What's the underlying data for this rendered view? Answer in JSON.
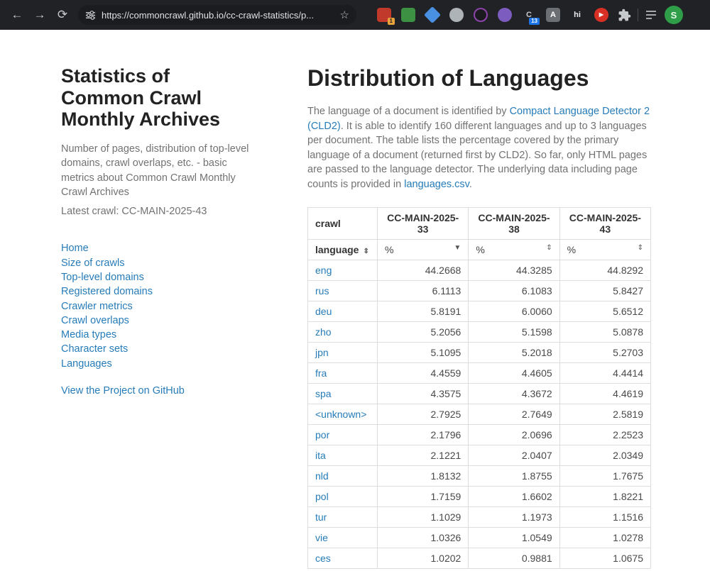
{
  "browser": {
    "url": "https://commoncrawl.github.io/cc-crawl-statistics/p...",
    "icons": {
      "back": "←",
      "forward": "→",
      "reload": "⟳",
      "star": "☆"
    },
    "avatar_letter": "S",
    "extensions": [
      {
        "name": "extension-icon-1",
        "shape": "rounded",
        "bg": "#c0392b",
        "badge": "1",
        "badge_bg": "#e8a33d",
        "badge_fg": "#222"
      },
      {
        "name": "extension-icon-2",
        "shape": "rounded",
        "bg": "#3d9142"
      },
      {
        "name": "extension-icon-3",
        "shape": "diamond",
        "bg": "#4a90e2"
      },
      {
        "name": "extension-icon-4",
        "shape": "circle",
        "bg": "#aeb3b8"
      },
      {
        "name": "extension-icon-5",
        "shape": "circle",
        "bg": "#1b1b1f",
        "border": "#8e44ad"
      },
      {
        "name": "extension-icon-6",
        "shape": "circle",
        "bg": "#7c5cbf"
      },
      {
        "name": "extension-icon-7",
        "shape": "none",
        "fg": "#c6c9cc",
        "glyph": "C",
        "badge": "13",
        "badge_bg": "#1a73e8",
        "badge_fg": "#fff"
      },
      {
        "name": "extension-icon-8",
        "shape": "rounded",
        "bg": "#6b6f73",
        "fg": "#ffffff",
        "glyph": "A"
      },
      {
        "name": "extension-icon-9",
        "shape": "none",
        "fg": "#e8eaed",
        "glyph": "hi"
      },
      {
        "name": "extension-icon-10",
        "shape": "circle",
        "bg": "#d93025",
        "fg": "#ffffff",
        "glyph": "▶"
      }
    ]
  },
  "sidebar": {
    "title": "Statistics of Common Crawl Monthly Archives",
    "description": "Number of pages, distribution of top-level domains, crawl overlaps, etc. - basic metrics about Common Crawl Monthly Crawl Archives",
    "latest_crawl": "Latest crawl: CC-MAIN-2025-43",
    "nav": [
      "Home",
      "Size of crawls",
      "Top-level domains",
      "Registered domains",
      "Crawler metrics",
      "Crawl overlaps",
      "Media types",
      "Character sets",
      "Languages"
    ],
    "github_link": "View the Project on GitHub"
  },
  "main": {
    "title": "Distribution of Languages",
    "intro": [
      {
        "text": "The language of a document is identified by "
      },
      {
        "link": "Compact Language Detector 2 (CLD2)"
      },
      {
        "text": ". It is able to identify 160 different languages and up to 3 languages per document. The table lists the percentage covered by the primary language of a document (returned first by CLD2). So far, only HTML pages are passed to the language detector. The underlying data including page counts is provided in "
      },
      {
        "link": "languages.csv"
      },
      {
        "text": "."
      }
    ],
    "table": {
      "crawl_header": "crawl",
      "crawls": [
        "CC-MAIN-2025-33",
        "CC-MAIN-2025-38",
        "CC-MAIN-2025-43"
      ],
      "sort_cells": [
        {
          "label": "language",
          "icon": "⇕"
        },
        {
          "label": "%",
          "icon": "▼"
        },
        {
          "label": "%",
          "icon": "⇕"
        },
        {
          "label": "%",
          "icon": "⇕"
        }
      ],
      "rows": [
        {
          "lang": "eng",
          "values": [
            "44.2668",
            "44.3285",
            "44.8292"
          ]
        },
        {
          "lang": "rus",
          "values": [
            "6.1113",
            "6.1083",
            "5.8427"
          ]
        },
        {
          "lang": "deu",
          "values": [
            "5.8191",
            "6.0060",
            "5.6512"
          ]
        },
        {
          "lang": "zho",
          "values": [
            "5.2056",
            "5.1598",
            "5.0878"
          ]
        },
        {
          "lang": "jpn",
          "values": [
            "5.1095",
            "5.2018",
            "5.2703"
          ]
        },
        {
          "lang": "fra",
          "values": [
            "4.4559",
            "4.4605",
            "4.4414"
          ]
        },
        {
          "lang": "spa",
          "values": [
            "4.3575",
            "4.3672",
            "4.4619"
          ]
        },
        {
          "lang": "<unknown>",
          "values": [
            "2.7925",
            "2.7649",
            "2.5819"
          ]
        },
        {
          "lang": "por",
          "values": [
            "2.1796",
            "2.0696",
            "2.2523"
          ]
        },
        {
          "lang": "ita",
          "values": [
            "2.1221",
            "2.0407",
            "2.0349"
          ]
        },
        {
          "lang": "nld",
          "values": [
            "1.8132",
            "1.8755",
            "1.7675"
          ]
        },
        {
          "lang": "pol",
          "values": [
            "1.7159",
            "1.6602",
            "1.8221"
          ]
        },
        {
          "lang": "tur",
          "values": [
            "1.1029",
            "1.1973",
            "1.1516"
          ]
        },
        {
          "lang": "vie",
          "values": [
            "1.0326",
            "1.0549",
            "1.0278"
          ]
        },
        {
          "lang": "ces",
          "values": [
            "1.0202",
            "0.9881",
            "1.0675"
          ]
        }
      ]
    }
  }
}
